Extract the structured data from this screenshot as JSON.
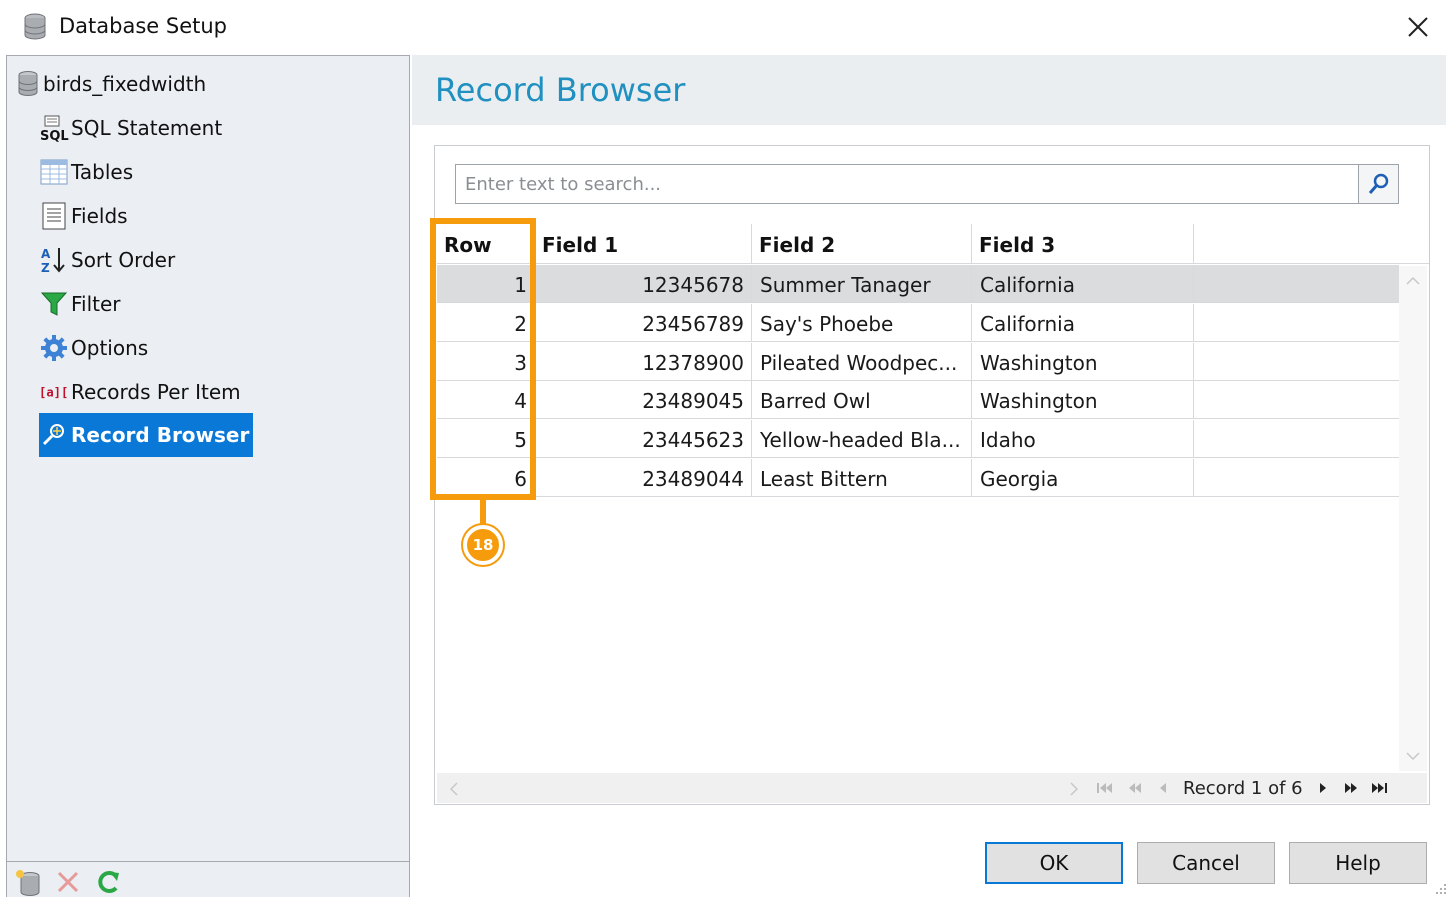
{
  "window": {
    "title": "Database Setup"
  },
  "tree": {
    "root": "birds_fixedwidth",
    "items": [
      {
        "label": "SQL Statement",
        "icon": "sql-icon"
      },
      {
        "label": "Tables",
        "icon": "table-icon"
      },
      {
        "label": "Fields",
        "icon": "fields-icon"
      },
      {
        "label": "Sort Order",
        "icon": "sort-icon"
      },
      {
        "label": "Filter",
        "icon": "filter-icon"
      },
      {
        "label": "Options",
        "icon": "gear-icon"
      },
      {
        "label": "Records Per Item",
        "icon": "records-per-item-icon"
      },
      {
        "label": "Record Browser",
        "icon": "record-browser-icon",
        "selected": true
      }
    ]
  },
  "page": {
    "title": "Record Browser"
  },
  "search": {
    "placeholder": "Enter text to search..."
  },
  "grid": {
    "columns": [
      "Row",
      "Field 1",
      "Field 2",
      "Field 3"
    ],
    "rows": [
      [
        "1",
        "12345678",
        "Summer Tanager",
        "California"
      ],
      [
        "2",
        "23456789",
        "Say's Phoebe",
        "California"
      ],
      [
        "3",
        "12378900",
        "Pileated Woodpec...",
        "Washington"
      ],
      [
        "4",
        "23489045",
        "Barred Owl",
        "Washington"
      ],
      [
        "5",
        "23445623",
        "Yellow-headed Bla...",
        "Idaho"
      ],
      [
        "6",
        "23489044",
        "Least Bittern",
        "Georgia"
      ]
    ],
    "active_row": 1
  },
  "navigator": {
    "text": "Record 1 of 6"
  },
  "annotation": {
    "number": "18",
    "color": "#f59b0c"
  },
  "buttons": {
    "ok": "OK",
    "cancel": "Cancel",
    "help": "Help"
  },
  "colors": {
    "accent": "#0a78d7",
    "title": "#2090c0"
  }
}
